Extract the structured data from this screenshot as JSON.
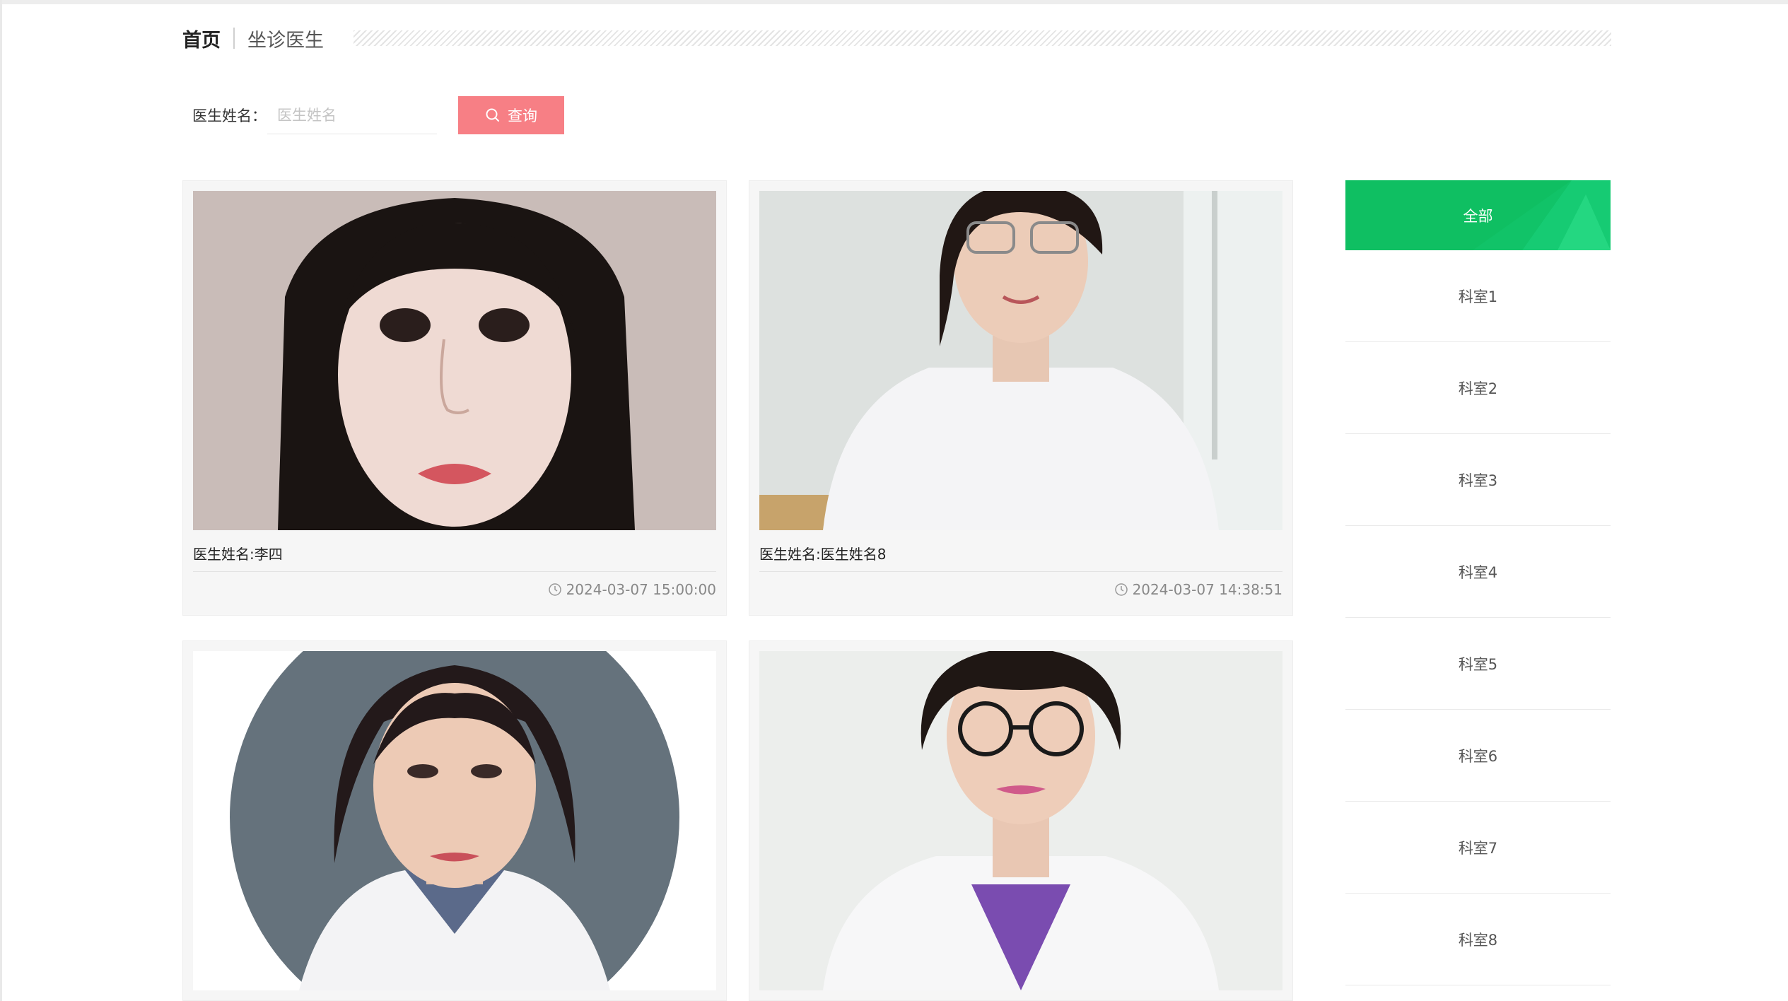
{
  "breadcrumb": {
    "home": "首页",
    "current": "坐诊医生"
  },
  "search": {
    "label": "医生姓名：",
    "placeholder": "医生姓名",
    "button_label": "查询"
  },
  "doctors": [
    {
      "name": "医生姓名:李四",
      "time": "2024-03-07 15:00:00"
    },
    {
      "name": "医生姓名:医生姓名8",
      "time": "2024-03-07 14:38:51"
    },
    {
      "name": "",
      "time": ""
    },
    {
      "name": "",
      "time": ""
    }
  ],
  "sidebar": {
    "all_label": "全部",
    "items": [
      "科室1",
      "科室2",
      "科室3",
      "科室4",
      "科室5",
      "科室6",
      "科室7",
      "科室8"
    ]
  },
  "colors": {
    "accent_green": "#0fbf62",
    "search_button": "#f77f85"
  }
}
